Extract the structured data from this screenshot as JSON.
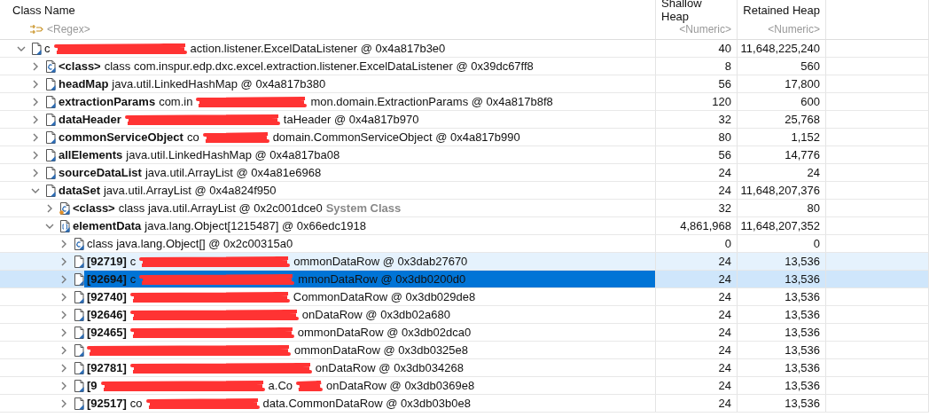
{
  "table": {
    "columns": [
      {
        "label": "Class Name",
        "filter": "<Regex>"
      },
      {
        "label": "Shallow Heap",
        "filter": "<Numeric>"
      },
      {
        "label": "Retained Heap",
        "filter": "<Numeric>"
      }
    ],
    "rows": [
      {
        "kind": "object",
        "expanded": true,
        "selected": false,
        "highlighted": false,
        "parts": [
          "c",
          "action.listener.ExcelDataListener @ 0x4a817b3e0"
        ],
        "shallow": "40",
        "retained": "11,648,225,240",
        "children": [
          {
            "kind": "class",
            "expanded": false,
            "selected": false,
            "highlighted": false,
            "name": "<class>",
            "parts": [
              "class com.inspur.edp.dxc.excel.extraction.listener.ExcelDataListener @ 0x39dc67ff8"
            ],
            "shallow": "8",
            "retained": "560"
          },
          {
            "kind": "object",
            "expanded": false,
            "selected": false,
            "highlighted": false,
            "name": "headMap",
            "parts": [
              "java.util.LinkedHashMap @ 0x4a817b380"
            ],
            "shallow": "56",
            "retained": "17,800"
          },
          {
            "kind": "object",
            "expanded": false,
            "selected": false,
            "highlighted": false,
            "name": "extractionParams",
            "parts": [
              "com.in",
              "mon.domain.ExtractionParams @ 0x4a817b8f8"
            ],
            "shallow": "120",
            "retained": "600"
          },
          {
            "kind": "object",
            "expanded": false,
            "selected": false,
            "highlighted": false,
            "name": "dataHeader",
            "parts": [
              "taHeader @ 0x4a817b970"
            ],
            "shallow": "32",
            "retained": "25,768"
          },
          {
            "kind": "object",
            "expanded": false,
            "selected": false,
            "highlighted": false,
            "name": "commonServiceObject",
            "parts": [
              "co",
              "domain.CommonServiceObject @ 0x4a817b990"
            ],
            "shallow": "80",
            "retained": "1,152"
          },
          {
            "kind": "object",
            "expanded": false,
            "selected": false,
            "highlighted": false,
            "name": "allElements",
            "parts": [
              "java.util.LinkedHashMap @ 0x4a817ba08"
            ],
            "shallow": "56",
            "retained": "14,776"
          },
          {
            "kind": "object",
            "expanded": false,
            "selected": false,
            "highlighted": false,
            "name": "sourceDataList",
            "parts": [
              "java.util.ArrayList @ 0x4a81e6968"
            ],
            "shallow": "24",
            "retained": "24"
          },
          {
            "kind": "object",
            "expanded": true,
            "selected": false,
            "highlighted": false,
            "name": "dataSet",
            "parts": [
              "java.util.ArrayList @ 0x4a824f950"
            ],
            "shallow": "24",
            "retained": "11,648,207,376",
            "children": [
              {
                "kind": "system-class",
                "expanded": false,
                "selected": false,
                "highlighted": false,
                "name": "<class>",
                "parts": [
                  "class java.util.ArrayList @ 0x2c001dce0"
                ],
                "suffix": "System Class",
                "shallow": "32",
                "retained": "80"
              },
              {
                "kind": "array",
                "expanded": true,
                "selected": false,
                "highlighted": false,
                "name": "elementData",
                "parts": [
                  "java.lang.Object[1215487] @ 0x66edc1918"
                ],
                "shallow": "4,861,968",
                "retained": "11,648,207,352",
                "children": [
                  {
                    "kind": "class",
                    "expanded": false,
                    "selected": false,
                    "highlighted": false,
                    "parts": [
                      "class java.lang.Object[] @ 0x2c00315a0"
                    ],
                    "shallow": "0",
                    "retained": "0"
                  },
                  {
                    "kind": "object",
                    "expanded": false,
                    "selected": false,
                    "highlighted": true,
                    "name": "[92719]",
                    "parts": [
                      "c",
                      "ommonDataRow @ 0x3dab27670"
                    ],
                    "shallow": "24",
                    "retained": "13,536"
                  },
                  {
                    "kind": "object",
                    "expanded": false,
                    "selected": true,
                    "highlighted": false,
                    "name": "[92694]",
                    "parts": [
                      "c",
                      "mmonDataRow @ 0x3db0200d0"
                    ],
                    "shallow": "24",
                    "retained": "13,536"
                  },
                  {
                    "kind": "object",
                    "expanded": false,
                    "selected": false,
                    "highlighted": false,
                    "name": "[92740]",
                    "parts": [
                      "CommonDataRow @ 0x3db029de8"
                    ],
                    "shallow": "24",
                    "retained": "13,536"
                  },
                  {
                    "kind": "object",
                    "expanded": false,
                    "selected": false,
                    "highlighted": false,
                    "name": "[92646]",
                    "parts": [
                      "onDataRow @ 0x3db02a680"
                    ],
                    "shallow": "24",
                    "retained": "13,536"
                  },
                  {
                    "kind": "object",
                    "expanded": false,
                    "selected": false,
                    "highlighted": false,
                    "name": "[92465]",
                    "parts": [
                      "ommonDataRow @ 0x3db02dca0"
                    ],
                    "shallow": "24",
                    "retained": "13,536"
                  },
                  {
                    "kind": "object",
                    "expanded": false,
                    "selected": false,
                    "highlighted": false,
                    "parts": [
                      "ommonDataRow @ 0x3db0325e8"
                    ],
                    "shallow": "24",
                    "retained": "13,536"
                  },
                  {
                    "kind": "object",
                    "expanded": false,
                    "selected": false,
                    "highlighted": false,
                    "name": "[92781]",
                    "parts": [
                      "onDataRow @ 0x3db034268"
                    ],
                    "shallow": "24",
                    "retained": "13,536"
                  },
                  {
                    "kind": "object",
                    "expanded": false,
                    "selected": false,
                    "highlighted": false,
                    "name": "[9",
                    "parts": [
                      "a.Co",
                      "onDataRow @ 0x3db0369e8"
                    ],
                    "shallow": "24",
                    "retained": "13,536"
                  },
                  {
                    "kind": "object",
                    "expanded": false,
                    "selected": false,
                    "highlighted": false,
                    "name": "[92517]",
                    "parts": [
                      "co",
                      "data.CommonDataRow @ 0x3db03b0e8"
                    ],
                    "shallow": "24",
                    "retained": "13,536"
                  }
                ]
              }
            ]
          }
        ]
      }
    ]
  }
}
